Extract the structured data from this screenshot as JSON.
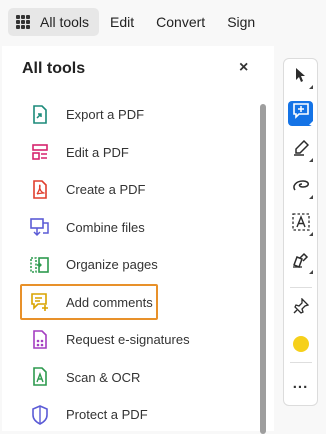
{
  "topbar": {
    "tabs": [
      {
        "label": "All tools"
      },
      {
        "label": "Edit"
      },
      {
        "label": "Convert"
      },
      {
        "label": "Sign"
      }
    ]
  },
  "panel": {
    "title": "All tools",
    "close_glyph": "×",
    "items": [
      {
        "label": "Export a PDF",
        "icon": "export-pdf-icon",
        "color": "#1b8a7a"
      },
      {
        "label": "Edit a PDF",
        "icon": "edit-pdf-icon",
        "color": "#d6246e"
      },
      {
        "label": "Create a PDF",
        "icon": "create-pdf-icon",
        "color": "#e03e2d"
      },
      {
        "label": "Combine files",
        "icon": "combine-files-icon",
        "color": "#5b5bd6"
      },
      {
        "label": "Organize pages",
        "icon": "organize-pages-icon",
        "color": "#2d9a4e"
      },
      {
        "label": "Add comments",
        "icon": "add-comments-icon",
        "color": "#d9a400",
        "highlighted": true
      },
      {
        "label": "Request e-signatures",
        "icon": "request-esignatures-icon",
        "color": "#a43ec1"
      },
      {
        "label": "Scan & OCR",
        "icon": "scan-ocr-icon",
        "color": "#2d9a4e"
      },
      {
        "label": "Protect a PDF",
        "icon": "protect-pdf-icon",
        "color": "#5b5bd6"
      }
    ],
    "highlight_color": "#e8912a"
  },
  "toolbar": {
    "tools": [
      {
        "icon": "select-cursor-icon"
      },
      {
        "icon": "add-comment-icon",
        "selected": true
      },
      {
        "icon": "highlight-pen-icon"
      },
      {
        "icon": "draw-freeform-icon"
      },
      {
        "icon": "add-text-icon",
        "glyph": "A"
      },
      {
        "icon": "signature-pen-icon"
      },
      {
        "icon": "pin-icon"
      },
      {
        "icon": "color-dot-icon",
        "color": "#f6d01b"
      },
      {
        "icon": "more-options-icon",
        "glyph": "..."
      }
    ],
    "accent": "#1473e6"
  }
}
